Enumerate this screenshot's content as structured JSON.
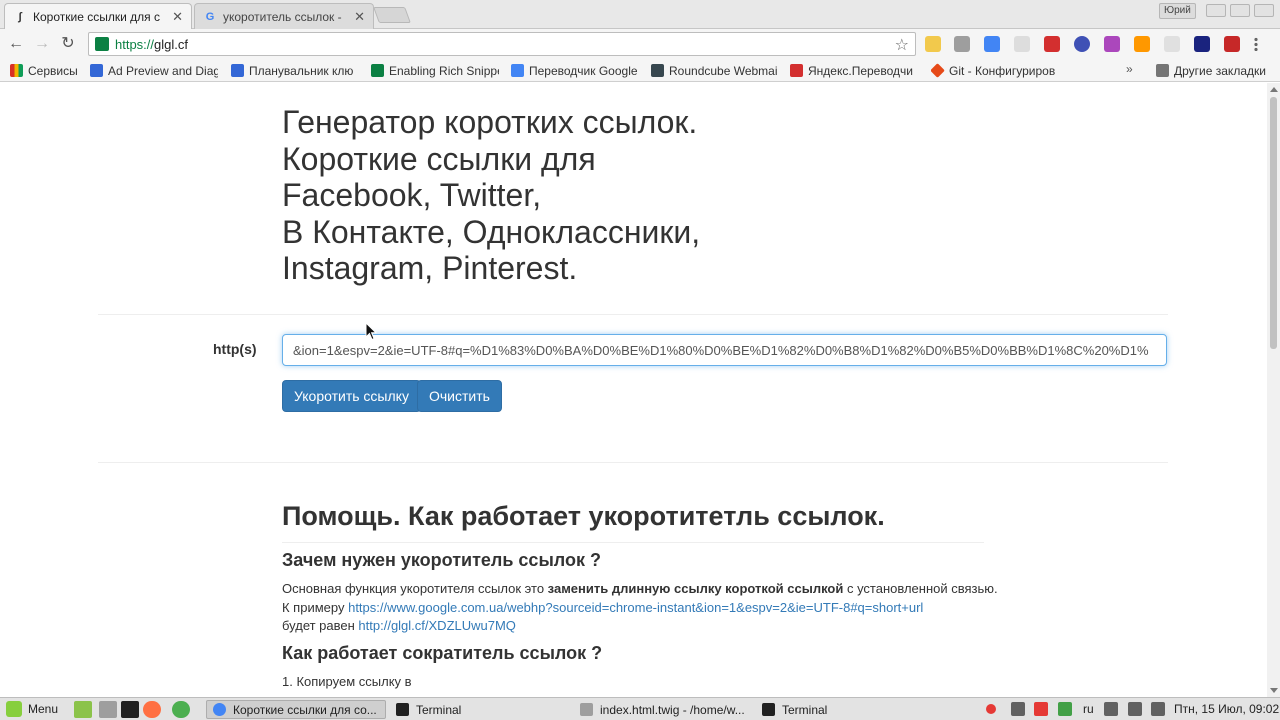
{
  "browser": {
    "tabs": [
      {
        "title": "Короткие ссылки для с",
        "active": true
      },
      {
        "title": "укоротитель ссылок - ",
        "active": false
      }
    ],
    "user_badge": "Юрий",
    "address": {
      "scheme": "https://",
      "host": "glgl.cf"
    }
  },
  "bookmarks": {
    "items": [
      {
        "label": "Сервисы",
        "color": "#d93025"
      },
      {
        "label": "Ad Preview and Diag",
        "color": "#3367d6"
      },
      {
        "label": "Планувальник клю",
        "color": "#3367d6"
      },
      {
        "label": "Enabling Rich Snippe",
        "color": "#0b8043"
      },
      {
        "label": "Переводчик Google",
        "color": "#4285f4"
      },
      {
        "label": "Roundcube Webmail",
        "color": "#37474f"
      },
      {
        "label": "Яндекс.Переводчи",
        "color": "#d32f2f"
      },
      {
        "label": "Git - Конфигуриров",
        "color": "#e64a19"
      }
    ],
    "more": "»",
    "other": "Другие закладки"
  },
  "page": {
    "hero_lines": [
      "Генератор коротких ссылок.",
      "Короткие ссылки для",
      "Facebook, Twitter,",
      "В Контакте, Одноклассники,",
      "Instagram, Pinterest."
    ],
    "form": {
      "label": "http(s)",
      "url_value": "&ion=1&espv=2&ie=UTF-8#q=%D1%83%D0%BA%D0%BE%D1%80%D0%BE%D1%82%D0%B8%D1%82%D0%B5%D0%BB%D1%8C%20%D1%",
      "shorten_label": "Укоротить ссылку",
      "clear_label": "Очистить"
    },
    "help": {
      "title": "Помощь. Как работает укоротитетль ссылок.",
      "why_heading": "Зачем нужен укоротитель ссылок ?",
      "para_1": "Основная функция укоротителя ссылок это ",
      "para_bold": "заменить длинную ссылку короткой ссылкой",
      "para_2": " с установленной связью. К примеру ",
      "example_long": "https://www.google.com.ua/webhp?sourceid=chrome-instant&ion=1&espv=2&ie=UTF-8#q=short+url",
      "para_3": "будет равен ",
      "example_short": "http://glgl.cf/XDZLUwu7MQ",
      "how_heading": "Как работает сократитель ссылок ?",
      "step_1": "1. Копируем ссылку в"
    }
  },
  "taskbar": {
    "menu_label": "Menu",
    "tasks": [
      {
        "label": "Короткие ссылки для со...",
        "active": true
      },
      {
        "label": "Terminal",
        "active": false
      },
      {
        "label": "index.html.twig - /home/w...",
        "active": false
      },
      {
        "label": "Terminal",
        "active": false
      }
    ],
    "keyboard_layout": "ru",
    "clock": "Птн, 15 Июл, 09:02"
  }
}
